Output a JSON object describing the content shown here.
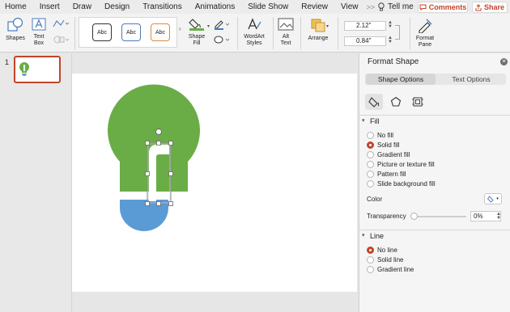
{
  "menubar": {
    "items": [
      "Home",
      "Insert",
      "Draw",
      "Design",
      "Transitions",
      "Animations",
      "Slide Show",
      "Review",
      "View"
    ],
    "more": ">>",
    "tell_me": "Tell me",
    "comments": "Comments",
    "share": "Share"
  },
  "ribbon": {
    "shapes": "Shapes",
    "text_box": [
      "Text",
      "Box"
    ],
    "style_sample": "Abc",
    "shape_fill": [
      "Shape",
      "Fill"
    ],
    "wordart": [
      "WordArt",
      "Styles"
    ],
    "alt_text": [
      "Alt",
      "Text"
    ],
    "arrange": "Arrange",
    "height": "2.12\"",
    "width": "0.84\"",
    "format_pane": [
      "Format",
      "Pane"
    ]
  },
  "slides": {
    "number": "1"
  },
  "pane": {
    "title": "Format Shape",
    "tabs": [
      "Shape Options",
      "Text Options"
    ],
    "fill": {
      "header": "Fill",
      "options": [
        "No fill",
        "Solid fill",
        "Gradient fill",
        "Picture or texture fill",
        "Pattern fill",
        "Slide background fill"
      ],
      "selected_index": 1,
      "color_label": "Color",
      "transparency_label": "Transparency",
      "transparency_value": "0%",
      "transparency_fraction": 0
    },
    "line": {
      "header": "Line",
      "options": [
        "No line",
        "Solid line",
        "Gradient line"
      ],
      "selected_index": 0
    }
  },
  "colors": {
    "accent": "#c3442a",
    "bulb_green": "#6aad46",
    "bulb_blue": "#5b9bd5"
  }
}
